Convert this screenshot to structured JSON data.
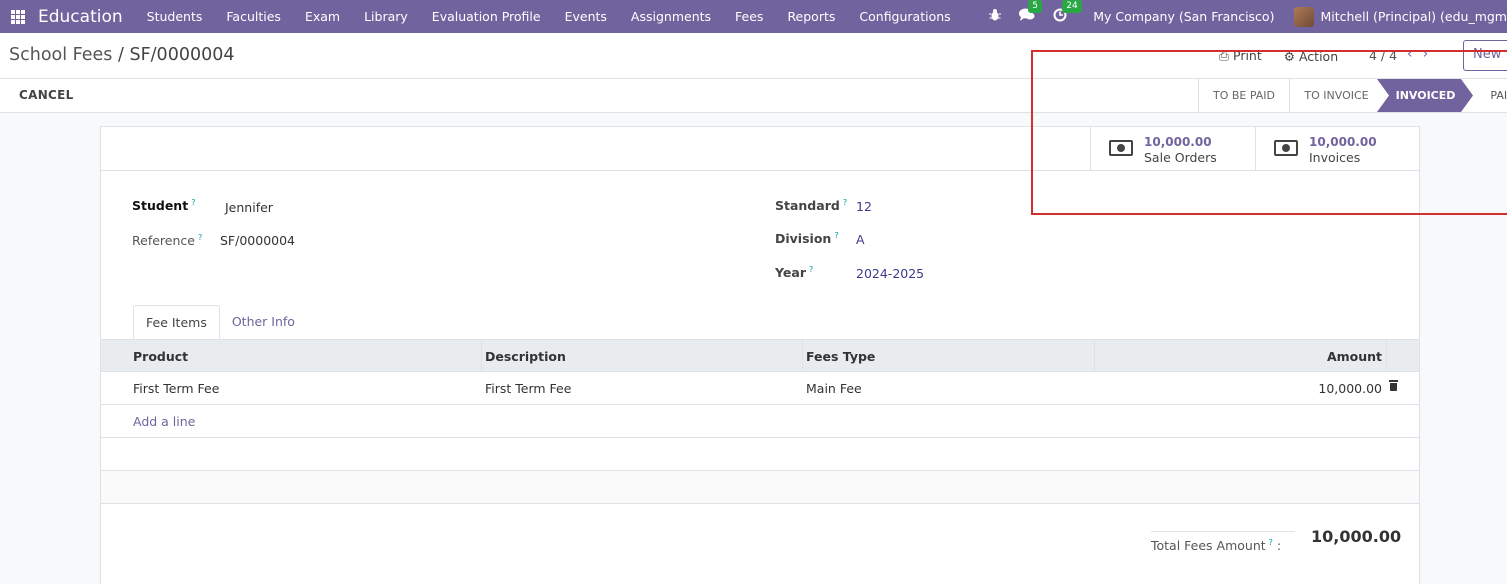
{
  "navbar": {
    "app_name": "Education",
    "menu": [
      "Students",
      "Faculties",
      "Exam",
      "Library",
      "Evaluation Profile",
      "Events",
      "Assignments",
      "Fees",
      "Reports",
      "Configurations"
    ],
    "messages_badge": "5",
    "activities_badge": "24",
    "company": "My Company (San Francisco)",
    "user": "Mitchell (Principal) (edu_mgm"
  },
  "control": {
    "breadcrumb_parent": "School Fees",
    "breadcrumb_sep": "/",
    "breadcrumb_current": "SF/0000004",
    "print_label": "Print",
    "action_label": "Action",
    "pager": "4 / 4",
    "new_label": "New"
  },
  "statusbar": {
    "cancel_label": "CANCEL",
    "stages": [
      "TO BE PAID",
      "TO INVOICE",
      "INVOICED",
      "PAID"
    ],
    "active_stage": "INVOICED"
  },
  "smart_buttons": [
    {
      "value": "10,000.00",
      "label": "Sale Orders",
      "icon": "money-icon"
    },
    {
      "value": "10,000.00",
      "label": "Invoices",
      "icon": "money-icon"
    }
  ],
  "form": {
    "student_label": "Student",
    "student": "Jennifer",
    "reference_label": "Reference",
    "reference": "SF/0000004",
    "standard_label": "Standard",
    "standard": "12",
    "division_label": "Division",
    "division": "A",
    "year_label": "Year",
    "year": "2024-2025",
    "help_mark": "?"
  },
  "tabs": [
    "Fee Items",
    "Other Info"
  ],
  "table": {
    "columns": [
      "Product",
      "Description",
      "Fees Type",
      "Amount"
    ],
    "rows": [
      {
        "product": "First Term Fee",
        "description": "First Term Fee",
        "fees_type": "Main Fee",
        "amount": "10,000.00"
      }
    ],
    "add_line": "Add a line"
  },
  "totals": {
    "label": "Total Fees Amount",
    "colon": ":",
    "value": "10,000.00"
  },
  "colors": {
    "brand": "#71639e",
    "annotation_box": "#d32f2f"
  }
}
